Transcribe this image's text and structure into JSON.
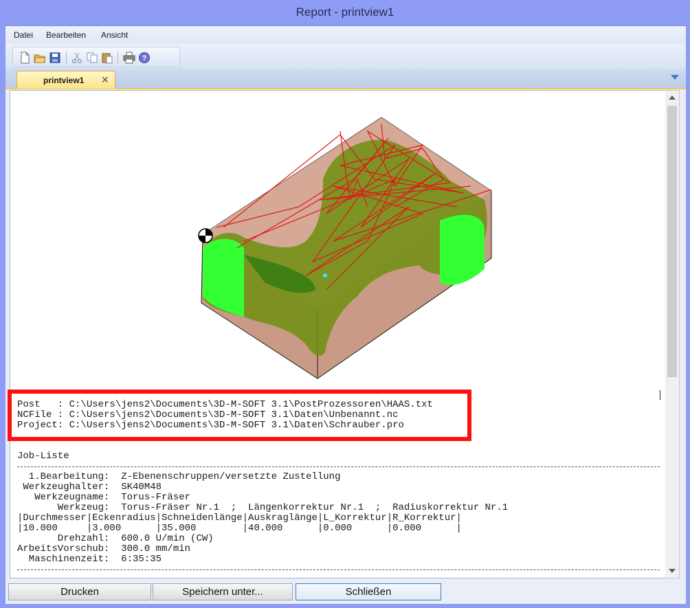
{
  "window": {
    "title": "Report - printview1"
  },
  "menu": {
    "items": [
      "Datei",
      "Bearbeiten",
      "Ansicht"
    ]
  },
  "toolbar": {
    "icons": [
      "new-document-icon",
      "open-folder-icon",
      "save-icon",
      "cut-icon",
      "copy-icon",
      "paste-icon",
      "print-icon",
      "help-icon"
    ]
  },
  "tab": {
    "label": "printview1"
  },
  "report": {
    "paths": [
      "Post   : C:\\Users\\jens2\\Documents\\3D-M-SOFT 3.1\\PostProzessoren\\HAAS.txt",
      "NCFile : C:\\Users\\jens2\\Documents\\3D-M-SOFT 3.1\\Daten\\Unbenannt.nc",
      "Project: C:\\Users\\jens2\\Documents\\3D-M-SOFT 3.1\\Daten\\Schrauber.pro"
    ],
    "job_heading": "Job-Liste",
    "job_lines": [
      "  1.Bearbeitung:  Z-Ebenenschruppen/versetzte Zustellung",
      " Werkzeughalter:  SK40M48",
      "   Werkzeugname:  Torus-Fräser",
      "       Werkzeug:  Torus-Fräser Nr.1  ;  Längenkorrektur Nr.1  ;  Radiuskorrektur Nr.1",
      "|Durchmesser|Eckenradius|Schneidenlänge|Auskraglänge|L_Korrektur|R_Korrektur|",
      "|10.000     |3.000      |35.000        |40.000      |0.000      |0.000      |",
      "       Drehzahl:  600.0 U/min (CW)",
      "ArbeitsVorschub:  300.0 mm/min",
      "  Maschinenzeit:  6:35:35"
    ]
  },
  "buttons": {
    "print": "Drucken",
    "save_as": "Speichern unter...",
    "close": "Schließen"
  },
  "colors": {
    "title_bar": "#8f9cf5",
    "highlight_box": "#ff1010",
    "toolpath_red": "#e01818",
    "stock_brown": "#c99a86",
    "machined_green": "#33ff33"
  }
}
